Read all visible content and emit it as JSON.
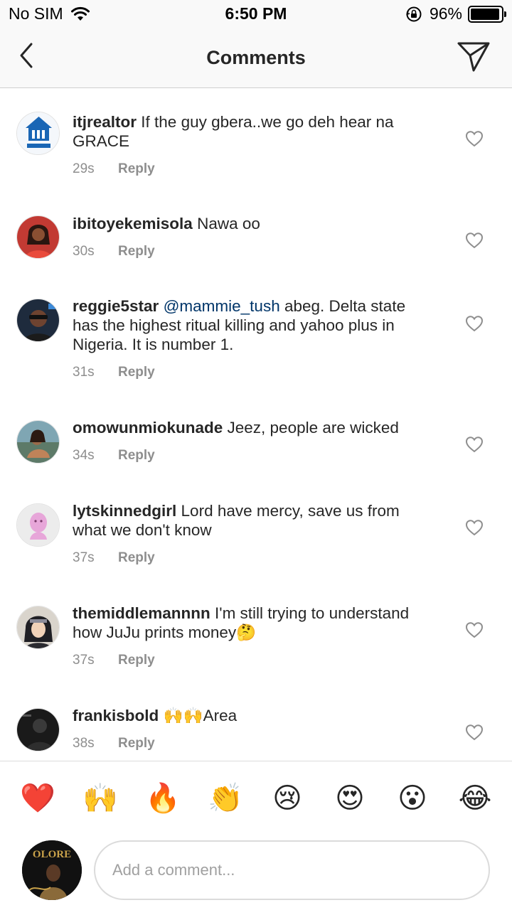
{
  "status_bar": {
    "carrier": "No SIM",
    "time": "6:50 PM",
    "battery_percent": "96%",
    "battery_level": 0.96,
    "icons": [
      "wifi-icon",
      "rotation-lock-icon",
      "battery-icon"
    ]
  },
  "header": {
    "title": "Comments",
    "back_icon": "chevron-left-icon",
    "send_icon": "paper-plane-icon"
  },
  "comments": [
    {
      "username": "itjrealtor",
      "text": " If the guy gbera..we go deh hear na GRACE",
      "time": "29s",
      "reply": "Reply"
    },
    {
      "username": "ibitoyekemisola",
      "text": " Nawa oo",
      "time": "30s",
      "reply": "Reply"
    },
    {
      "username": "reggie5star",
      "mention": "@mammie_tush",
      "text": " abeg. Delta state has the highest ritual killing and yahoo plus in Nigeria. It is number 1.",
      "time": "31s",
      "reply": "Reply"
    },
    {
      "username": "omowunmiokunade",
      "text": " Jeez, people are wicked",
      "time": "34s",
      "reply": "Reply"
    },
    {
      "username": "lytskinnedgirl",
      "text": " Lord have mercy, save us from what we don't know",
      "time": "37s",
      "reply": "Reply"
    },
    {
      "username": "themiddlemannnn",
      "text": " I'm still trying to understand how JuJu prints money🤔",
      "time": "37s",
      "reply": "Reply"
    },
    {
      "username": "frankisbold",
      "text": " 🙌🙌Area",
      "time": "38s",
      "reply": "Reply"
    }
  ],
  "emoji_bar": [
    "❤️",
    "🙌",
    "🔥",
    "👏",
    "😢",
    "😍",
    "😮",
    "😂"
  ],
  "composer": {
    "placeholder": "Add a comment...",
    "avatar_text": "OLORE"
  },
  "colors": {
    "text": "#262626",
    "secondary": "#8e8e8e",
    "mention": "#003569",
    "divider": "#dbdbdb"
  }
}
